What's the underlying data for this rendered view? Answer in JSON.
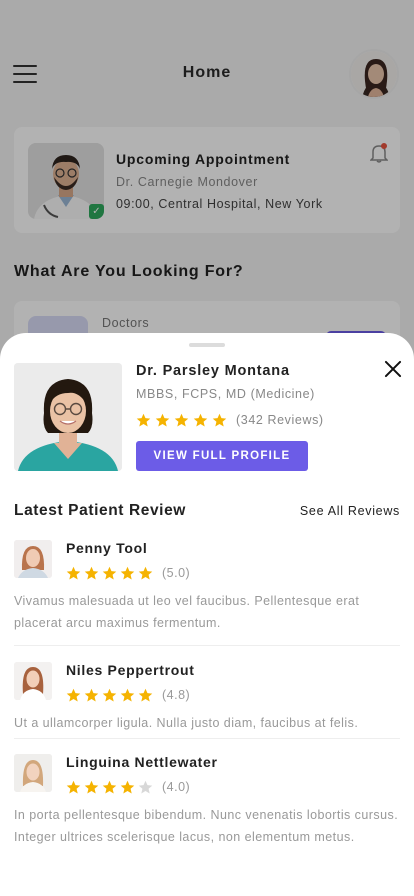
{
  "header": {
    "title": "Home",
    "menu_icon": "hamburger-icon",
    "avatar": "user-avatar"
  },
  "appointment": {
    "title": "Upcoming Appointment",
    "doctor": "Dr. Carnegie Mondover",
    "time_place": "09:00, Central Hospital, New York",
    "notification_icon": "bell-icon"
  },
  "section": {
    "looking_title": "What Are You Looking For?",
    "category_label": "Doctors"
  },
  "doctor": {
    "name": "Dr. Parsley Montana",
    "qualifications": "MBBS, FCPS, MD (Medicine)",
    "rating": 5,
    "reviews_label": "(342 Reviews)",
    "profile_button": "VIEW FULL PROFILE"
  },
  "reviews_section": {
    "title": "Latest Patient Review",
    "see_all": "See All Reviews"
  },
  "reviews": [
    {
      "name": "Penny Tool",
      "rating": 5,
      "score_label": "(5.0)",
      "text": "Vivamus malesuada ut leo vel faucibus. Pellentesque erat placerat arcu maximus fermentum."
    },
    {
      "name": "Niles Peppertrout",
      "rating": 5,
      "score_label": "(4.8)",
      "text": "Ut a ullamcorper ligula. Nulla justo diam, faucibus at felis."
    },
    {
      "name": "Linguina Nettlewater",
      "rating": 4,
      "score_label": "(4.0)",
      "text": "In porta pellentesque bibendum. Nunc venenatis lobortis cursus. Integer ultrices scelerisque lacus, non elementum metus."
    }
  ],
  "colors": {
    "accent": "#6c5ce7",
    "star": "#f5b301",
    "star_empty": "#d8d8d8",
    "verified": "#2eaa5e",
    "notification_dot": "#e8533f"
  }
}
